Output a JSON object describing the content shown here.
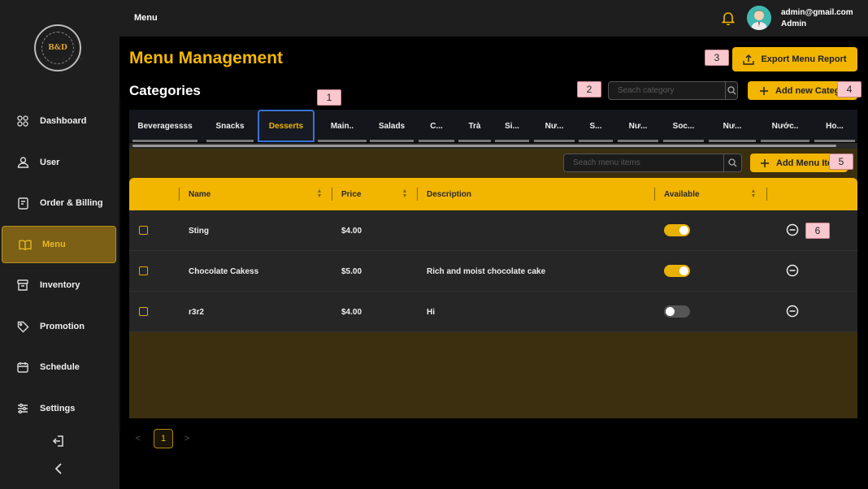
{
  "topbar": {
    "title": "Menu",
    "user_email": "admin@gmail.com",
    "user_role": "Admin"
  },
  "sidebar": {
    "logo_text": "B&D",
    "items": [
      {
        "label": "Dashboard",
        "icon": "dashboard-icon"
      },
      {
        "label": "User",
        "icon": "user-icon"
      },
      {
        "label": "Order & Billing",
        "icon": "order-billing-icon"
      },
      {
        "label": "Menu",
        "icon": "menu-book-icon",
        "active": true
      },
      {
        "label": "Inventory",
        "icon": "inventory-icon"
      },
      {
        "label": "Promotion",
        "icon": "promotion-tag-icon"
      },
      {
        "label": "Schedule",
        "icon": "calendar-icon"
      },
      {
        "label": "Settings",
        "icon": "settings-sliders-icon"
      }
    ]
  },
  "main": {
    "title": "Menu Management",
    "export_label": "Export Menu Report",
    "categories_title": "Categories",
    "category_search_placeholder": "Seach category",
    "add_category_label": "Add new Categ",
    "menu_search_placeholder": "Seach menu items",
    "add_menu_item_label": "Add Menu Ite",
    "tabs": [
      "Beveragessss",
      "Snacks",
      "Desserts",
      "Main..",
      "Salads",
      "C...",
      "Trà",
      "Si...",
      "Nư...",
      "S...",
      "Nư...",
      "Soc...",
      "Nư...",
      "Nước..",
      "Ho..."
    ],
    "active_tab": "Desserts",
    "table": {
      "headers": {
        "name": "Name",
        "price": "Price",
        "description": "Description",
        "available": "Available"
      },
      "rows": [
        {
          "name": "Sting",
          "price": "$4.00",
          "description": "",
          "available": true
        },
        {
          "name": "Chocolate Cakess",
          "price": "$5.00",
          "description": "Rich and moist chocolate cake",
          "available": true
        },
        {
          "name": "r3r2",
          "price": "$4.00",
          "description": "Hi",
          "available": false
        }
      ]
    },
    "pagination": {
      "prev": "<",
      "current": "1",
      "next": ">"
    }
  },
  "markers": [
    "1",
    "2",
    "3",
    "4",
    "5",
    "6"
  ],
  "colors": {
    "accent": "#f2b500",
    "panel": "#3b2f0f",
    "tab_active_border": "#3a73d6"
  }
}
